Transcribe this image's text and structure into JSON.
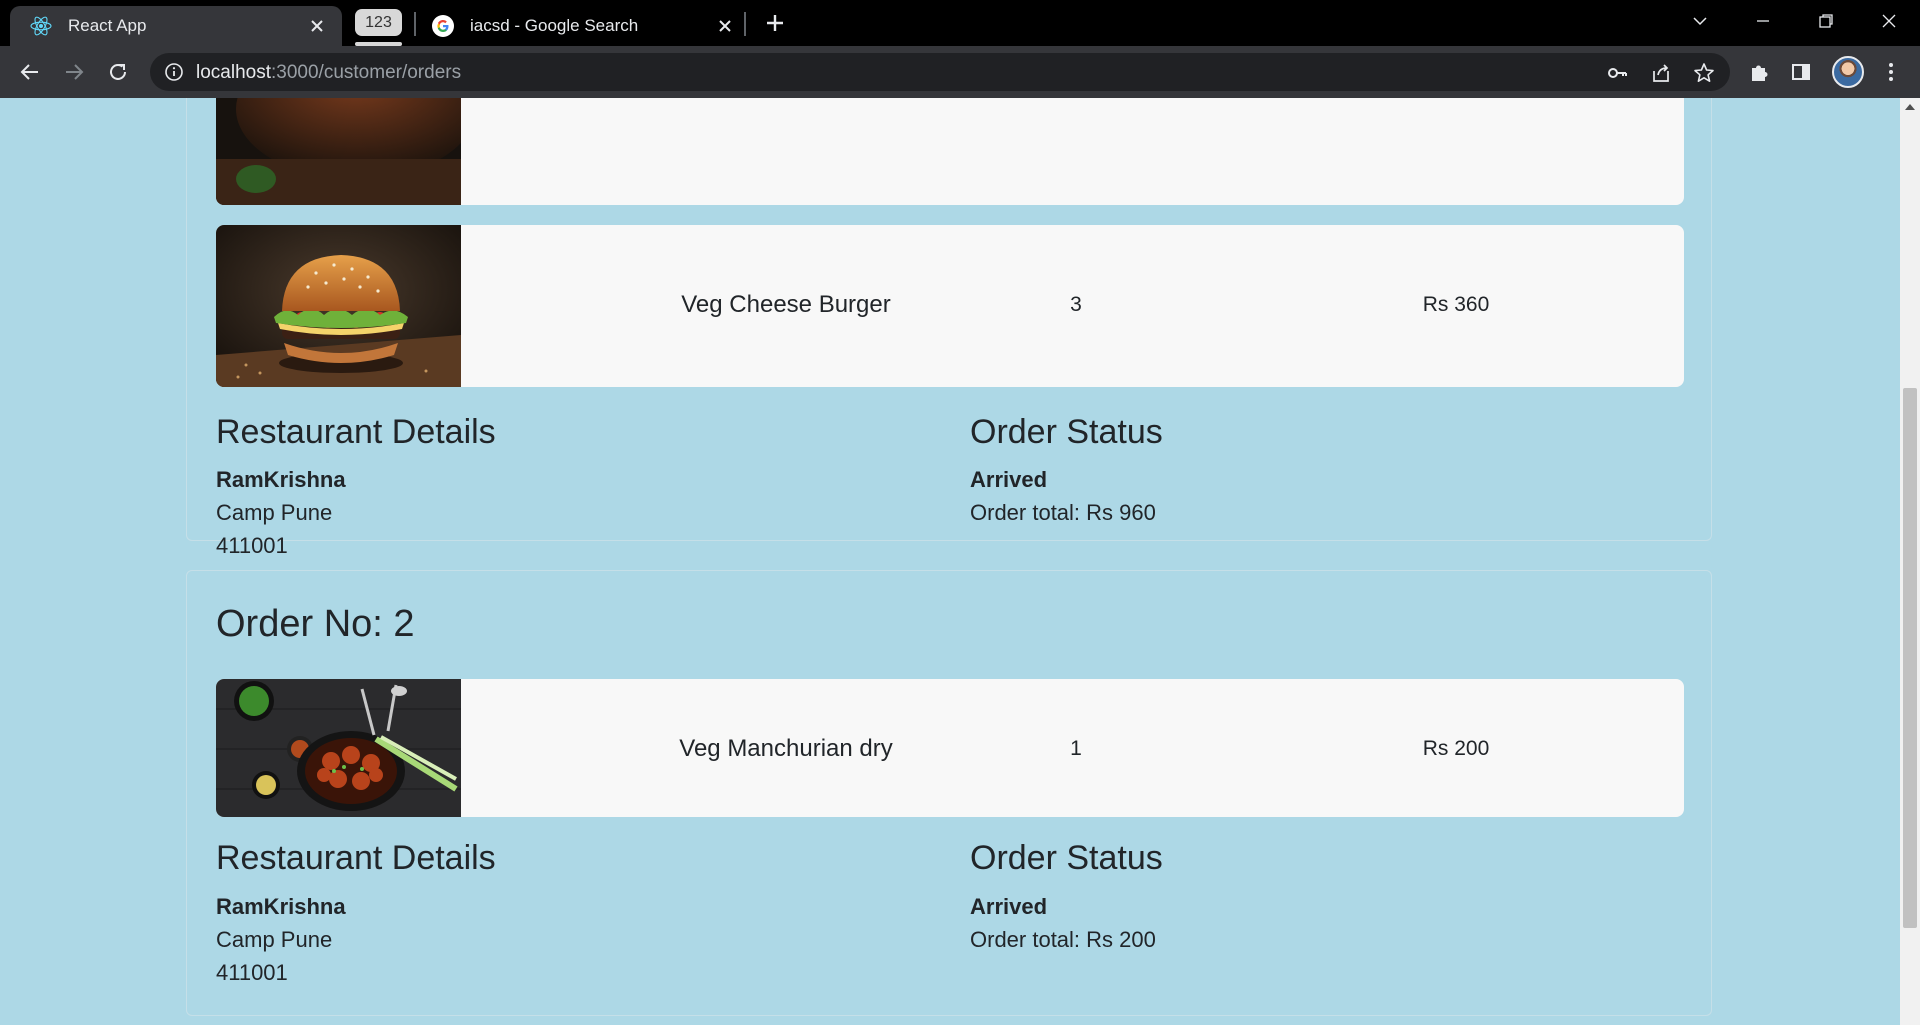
{
  "browser": {
    "active_tab": {
      "title": "React App"
    },
    "tab_group": {
      "label": "123"
    },
    "inactive_tab": {
      "title": "iacsd - Google Search"
    },
    "url": {
      "host": "localhost",
      "path": ":3000/customer/orders"
    }
  },
  "orders": [
    {
      "items": [
        {
          "name": "",
          "quantity": "",
          "price": "",
          "image": "pizza-photo"
        },
        {
          "name": "Veg Cheese Burger",
          "quantity": "3",
          "price": "Rs 360",
          "image": "burger-photo"
        }
      ],
      "restaurant": {
        "heading": "Restaurant Details",
        "name": "RamKrishna",
        "address_line": "Camp Pune",
        "pincode": "411001"
      },
      "status": {
        "heading": "Order Status",
        "value": "Arrived",
        "total": "Order total: Rs 960"
      }
    },
    {
      "title": "Order No: 2",
      "items": [
        {
          "name": "Veg Manchurian dry",
          "quantity": "1",
          "price": "Rs 200",
          "image": "manchurian-photo"
        }
      ],
      "restaurant": {
        "heading": "Restaurant Details",
        "name": "RamKrishna",
        "address_line": "Camp Pune",
        "pincode": "411001"
      },
      "status": {
        "heading": "Order Status",
        "value": "Arrived",
        "total": "Order total: Rs 200"
      }
    }
  ],
  "colors": {
    "page_bg": "#add8e6",
    "card_bg": "#f8f8f8",
    "text": "#212529"
  }
}
